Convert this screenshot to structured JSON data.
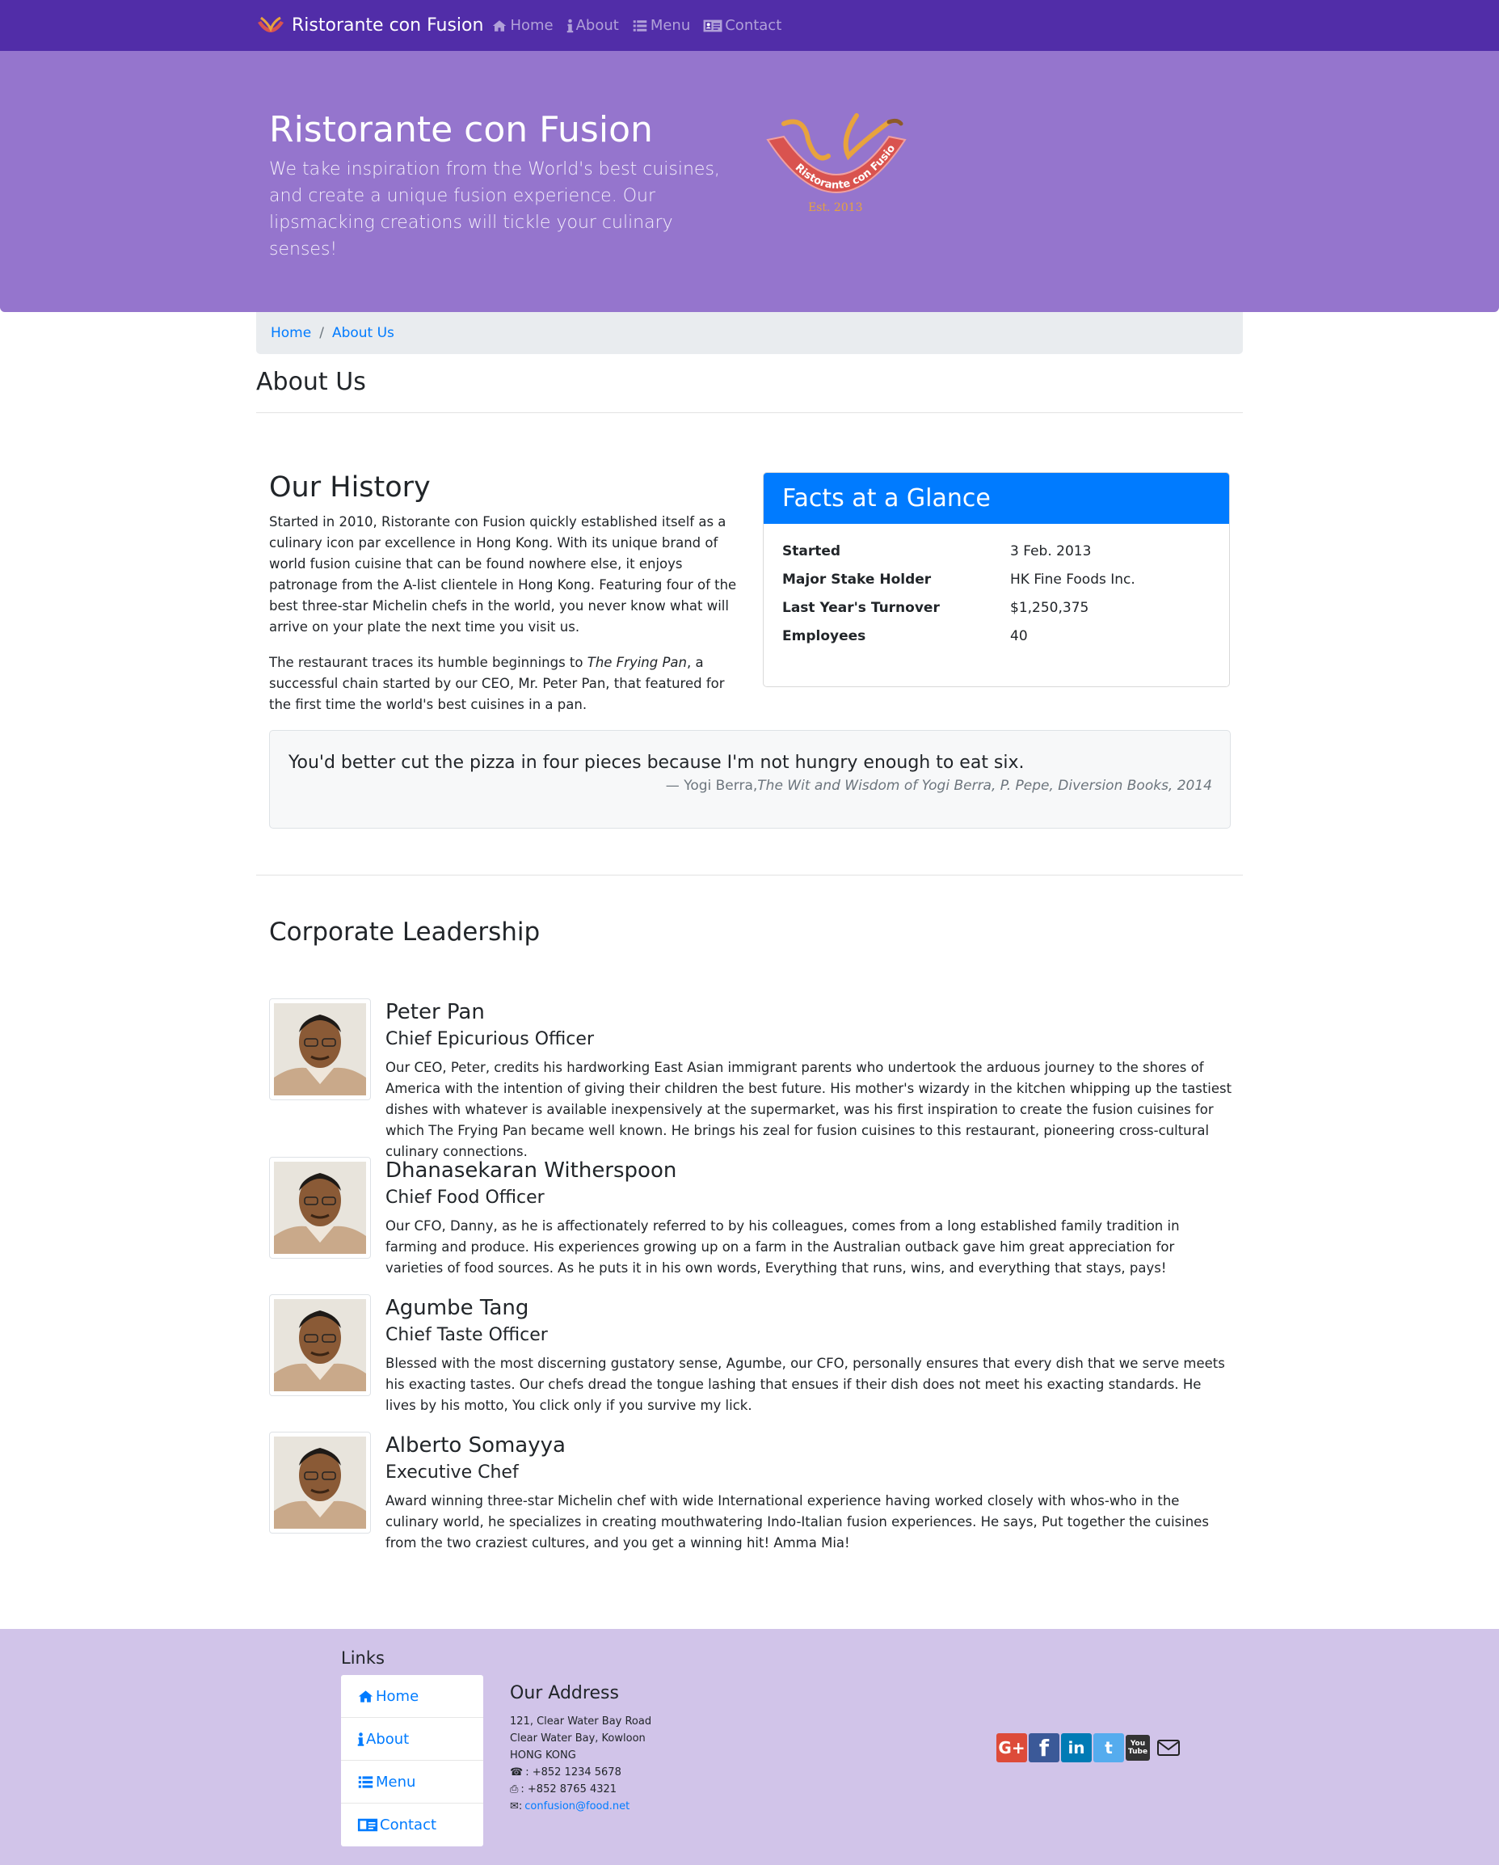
{
  "nav": {
    "brand": "Ristorante con Fusion",
    "items": [
      {
        "label": "Home",
        "icon": "home-icon"
      },
      {
        "label": "About",
        "icon": "info-icon"
      },
      {
        "label": "Menu",
        "icon": "list-icon"
      },
      {
        "label": "Contact",
        "icon": "address-card-icon"
      }
    ]
  },
  "jumbotron": {
    "title": "Ristorante con Fusion",
    "text": "We take inspiration from the World's best cuisines, and create a unique fusion experience. Our lipsmacking creations will tickle your culinary senses!",
    "logo_text": "Ristorante con Fusion",
    "logo_est": "Est. 2013"
  },
  "breadcrumb": {
    "home": "Home",
    "separator": "/",
    "current": "About Us"
  },
  "page_title": "About Us",
  "history": {
    "title": "Our History",
    "p1": "Started in 2010, Ristorante con Fusion quickly established itself as a culinary icon par excellence in Hong Kong. With its unique brand of world fusion cuisine that can be found nowhere else, it enjoys patronage from the A-list clientele in Hong Kong. Featuring four of the best three-star Michelin chefs in the world, you never know what will arrive on your plate the next time you visit us.",
    "p2_before": "The restaurant traces its humble beginnings to ",
    "p2_em": "The Frying Pan",
    "p2_after": ", a successful chain started by our CEO, Mr. Peter Pan, that featured for the first time the world's best cuisines in a pan."
  },
  "facts": {
    "title": "Facts at a Glance",
    "rows": [
      {
        "label": "Started",
        "value": "3 Feb. 2013"
      },
      {
        "label": "Major Stake Holder",
        "value": "HK Fine Foods Inc."
      },
      {
        "label": "Last Year's Turnover",
        "value": "$1,250,375"
      },
      {
        "label": "Employees",
        "value": "40"
      }
    ]
  },
  "quote": {
    "text": "You'd better cut the pizza in four pieces because I'm not hungry enough to eat six.",
    "author": "— Yogi Berra,",
    "source": "The Wit and Wisdom of Yogi Berra, P. Pepe, Diversion Books, 2014"
  },
  "leadership": {
    "title": "Corporate Leadership",
    "leaders": [
      {
        "name": "Peter Pan",
        "role": "Chief Epicurious Officer",
        "desc": "Our CEO, Peter, credits his hardworking East Asian immigrant parents who undertook the arduous journey to the shores of America with the intention of giving their children the best future. His mother's wizardy in the kitchen whipping up the tastiest dishes with whatever is available inexpensively at the supermarket, was his first inspiration to create the fusion cuisines for which The Frying Pan became well known. He brings his zeal for fusion cuisines to this restaurant, pioneering cross-cultural culinary connections."
      },
      {
        "name": "Dhanasekaran Witherspoon",
        "role": "Chief Food Officer",
        "desc": "Our CFO, Danny, as he is affectionately referred to by his colleagues, comes from a long established family tradition in farming and produce. His experiences growing up on a farm in the Australian outback gave him great appreciation for varieties of food sources. As he puts it in his own words, Everything that runs, wins, and everything that stays, pays!"
      },
      {
        "name": "Agumbe Tang",
        "role": "Chief Taste Officer",
        "desc": "Blessed with the most discerning gustatory sense, Agumbe, our CFO, personally ensures that every dish that we serve meets his exacting tastes. Our chefs dread the tongue lashing that ensues if their dish does not meet his exacting standards. He lives by his motto, You click only if you survive my lick."
      },
      {
        "name": "Alberto Somayya",
        "role": "Executive Chef",
        "desc": "Award winning three-star Michelin chef with wide International experience having worked closely with whos-who in the culinary world, he specializes in creating mouthwatering Indo-Italian fusion experiences. He says, Put together the cuisines from the two craziest cultures, and you get a winning hit! Amma Mia!"
      }
    ]
  },
  "footer": {
    "links_title": "Links",
    "links": [
      {
        "label": "Home",
        "icon": "home-icon"
      },
      {
        "label": "About",
        "icon": "info-icon"
      },
      {
        "label": "Menu",
        "icon": "list-icon"
      },
      {
        "label": "Contact",
        "icon": "address-card-icon"
      }
    ],
    "address_title": "Our Address",
    "address_lines": [
      "121, Clear Water Bay Road",
      "Clear Water Bay, Kowloon",
      "HONG KONG"
    ],
    "phone": ": +852 1234 5678",
    "fax": ": +852 8765 4321",
    "email": "confusion@food.net",
    "social": [
      {
        "label": "G+",
        "icon": "google-plus-icon",
        "color": "#dd4b39"
      },
      {
        "label": "f",
        "icon": "facebook-icon",
        "color": "#3b5998"
      },
      {
        "label": "in",
        "icon": "linkedin-icon",
        "color": "#007bb5"
      },
      {
        "label": "t",
        "icon": "twitter-icon",
        "color": "#55acee"
      },
      {
        "label": "You Tube",
        "icon": "youtube-icon",
        "color": "#333333"
      }
    ]
  },
  "colors": {
    "navbar": "#512da8",
    "jumbotron": "#9575cd",
    "footer": "#d1c4e9",
    "primary": "#007bff"
  }
}
